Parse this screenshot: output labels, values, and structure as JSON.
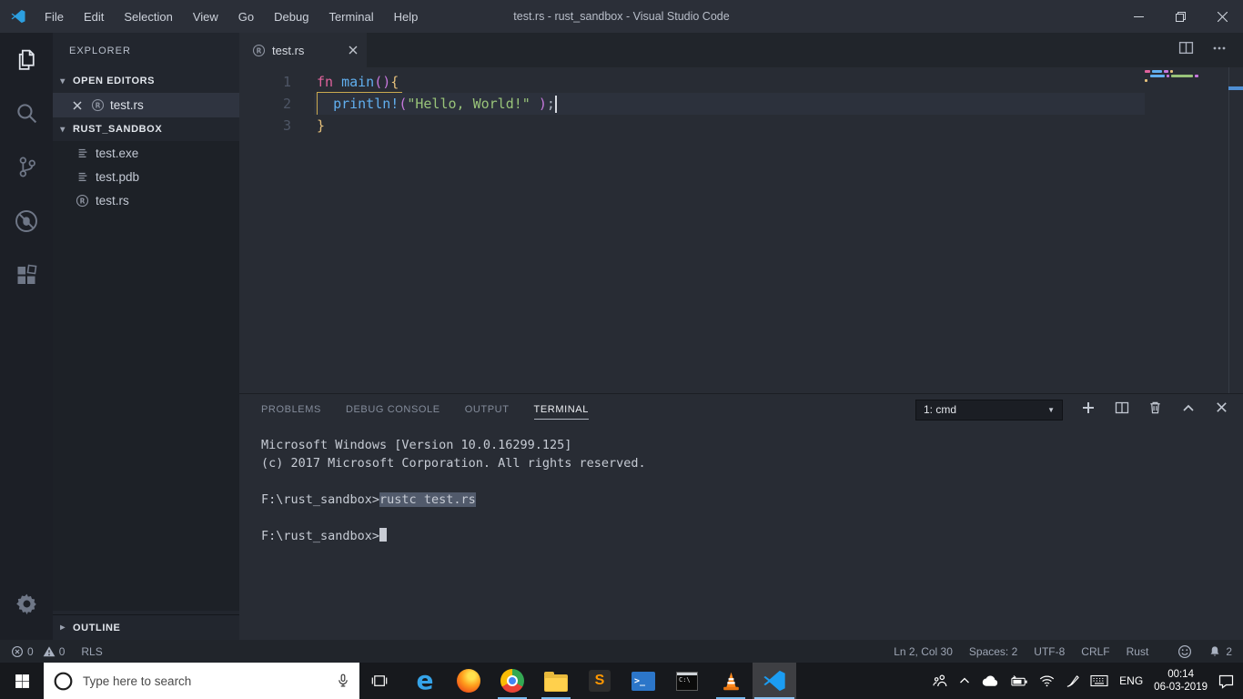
{
  "app": {
    "title": "test.rs - rust_sandbox - Visual Studio Code"
  },
  "title_bar": {
    "menus": [
      "File",
      "Edit",
      "Selection",
      "View",
      "Go",
      "Debug",
      "Terminal",
      "Help"
    ]
  },
  "activity_bar": {
    "items": [
      {
        "id": "explorer",
        "icon": "files-icon",
        "active": true
      },
      {
        "id": "search",
        "icon": "search-icon",
        "active": false
      },
      {
        "id": "source-control",
        "icon": "git-branch-icon",
        "active": false
      },
      {
        "id": "debug",
        "icon": "debug-icon",
        "active": false
      },
      {
        "id": "extensions",
        "icon": "extensions-icon",
        "active": false
      }
    ],
    "bottom": [
      {
        "id": "settings",
        "icon": "gear-icon"
      }
    ]
  },
  "sidebar": {
    "title": "EXPLORER",
    "open_editors": {
      "label": "OPEN EDITORS",
      "items": [
        {
          "file": "test.rs",
          "icon": "rust",
          "selected": true
        }
      ]
    },
    "folder": {
      "label": "RUST_SANDBOX",
      "items": [
        {
          "file": "test.exe",
          "icon": "file"
        },
        {
          "file": "test.pdb",
          "icon": "file"
        },
        {
          "file": "test.rs",
          "icon": "rust"
        }
      ]
    },
    "outline": {
      "label": "OUTLINE",
      "collapsed": true
    }
  },
  "editor": {
    "tab": {
      "label": "test.rs"
    },
    "cursor": {
      "line": 2,
      "col": 30
    },
    "lines": [
      {
        "num": "1",
        "tokens": [
          {
            "t": "fn",
            "c": "kw"
          },
          {
            "t": " ",
            "c": "pl"
          },
          {
            "t": "main",
            "c": "fnc"
          },
          {
            "t": "()",
            "c": "pr"
          },
          {
            "t": "{",
            "c": "br"
          }
        ]
      },
      {
        "num": "2",
        "current": true,
        "tokens": [
          {
            "t": "  ",
            "c": "pl"
          },
          {
            "t": "println!",
            "c": "mac"
          },
          {
            "t": "(",
            "c": "pr"
          },
          {
            "t": "\"Hello, World!\"",
            "c": "str"
          },
          {
            "t": " ",
            "c": "pl"
          },
          {
            "t": ")",
            "c": "pr"
          },
          {
            "t": ";",
            "c": "pl"
          }
        ]
      },
      {
        "num": "3",
        "tokens": [
          {
            "t": "}",
            "c": "br"
          }
        ]
      }
    ]
  },
  "panel": {
    "tabs": [
      {
        "label": "PROBLEMS",
        "active": false
      },
      {
        "label": "DEBUG CONSOLE",
        "active": false
      },
      {
        "label": "OUTPUT",
        "active": false
      },
      {
        "label": "TERMINAL",
        "active": true
      }
    ],
    "terminal_picker": {
      "value": "1: cmd"
    },
    "terminal": {
      "lines": [
        {
          "text": "Microsoft Windows [Version 10.0.16299.125]"
        },
        {
          "text": "(c) 2017 Microsoft Corporation. All rights reserved."
        },
        {
          "text": ""
        },
        {
          "prompt": "F:\\rust_sandbox>",
          "command": "rustc test.rs",
          "command_selected": true
        },
        {
          "text": ""
        },
        {
          "prompt": "F:\\rust_sandbox>",
          "cursor": true
        }
      ]
    }
  },
  "status_bar": {
    "errors": "0",
    "warnings": "0",
    "server": "RLS",
    "cursor_position": "Ln 2, Col 30",
    "indentation": "Spaces: 2",
    "encoding": "UTF-8",
    "eol": "CRLF",
    "language": "Rust",
    "notifications_count": "2"
  },
  "taskbar": {
    "search": {
      "placeholder": "Type here to search"
    },
    "apps": [
      {
        "name": "edge",
        "running": false,
        "active": false
      },
      {
        "name": "firefox",
        "running": false,
        "active": false
      },
      {
        "name": "chrome",
        "running": true,
        "active": false
      },
      {
        "name": "file-explorer",
        "running": true,
        "active": false
      },
      {
        "name": "sublime-text",
        "running": false,
        "active": false
      },
      {
        "name": "powershell",
        "running": false,
        "active": false
      },
      {
        "name": "command-prompt",
        "running": false,
        "active": false
      },
      {
        "name": "vlc",
        "running": true,
        "active": false
      },
      {
        "name": "vscode",
        "running": true,
        "active": true
      }
    ],
    "tray": {
      "language": "ENG",
      "time": "00:14",
      "date": "06-03-2019"
    }
  },
  "colors": {
    "accent": "#007acc",
    "keyword": "#df639c",
    "function": "#61afef",
    "string": "#98c379",
    "paren": "#c678dd",
    "brace": "#e5c07b",
    "selection": "#515a6b"
  }
}
